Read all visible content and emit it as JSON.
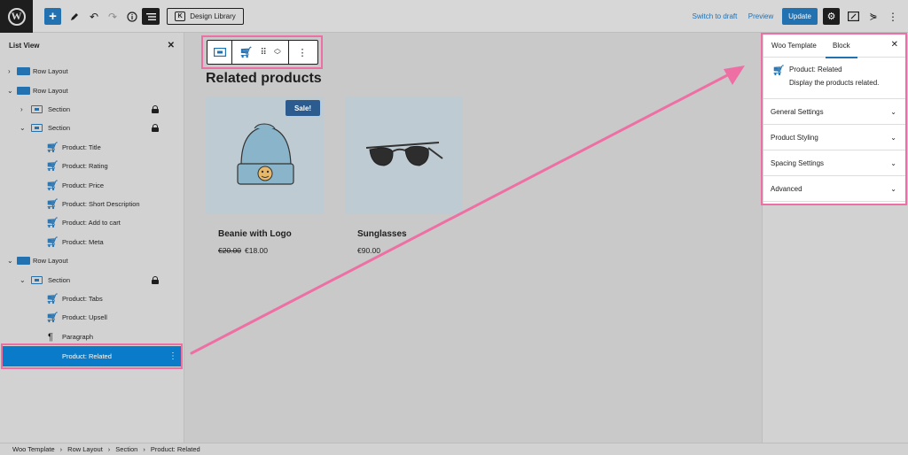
{
  "topbar": {
    "design_library_label": "Design Library",
    "design_library_icon_letter": "K",
    "switch_to_draft": "Switch to draft",
    "preview": "Preview",
    "update": "Update"
  },
  "listview": {
    "title": "List View",
    "items": [
      {
        "label": "Row Layout"
      },
      {
        "label": "Row Layout"
      },
      {
        "label": "Section"
      },
      {
        "label": "Section"
      },
      {
        "label": "Product: Title"
      },
      {
        "label": "Product: Rating"
      },
      {
        "label": "Product: Price"
      },
      {
        "label": "Product: Short Description"
      },
      {
        "label": "Product: Add to cart"
      },
      {
        "label": "Product: Meta"
      },
      {
        "label": "Row Layout"
      },
      {
        "label": "Section"
      },
      {
        "label": "Product: Tabs"
      },
      {
        "label": "Product: Upsell"
      },
      {
        "label": "Paragraph"
      },
      {
        "label": "Product: Related"
      }
    ]
  },
  "canvas": {
    "heading": "Related products",
    "products": [
      {
        "name": "Beanie with Logo",
        "old_price": "€20.00",
        "price": "€18.00",
        "badge": "Sale!"
      },
      {
        "name": "Sunglasses",
        "price": "€90.00"
      }
    ]
  },
  "settings": {
    "tabs": [
      "Woo Template",
      "Block"
    ],
    "active_tab": "Block",
    "block_title": "Product: Related",
    "block_description": "Display the products related.",
    "panels": [
      "General Settings",
      "Product Styling",
      "Spacing Settings",
      "Advanced"
    ]
  },
  "footer": {
    "breadcrumbs": [
      "Woo Template",
      "Row Layout",
      "Section",
      "Product: Related"
    ]
  },
  "colors": {
    "accent": "#2271b1",
    "highlight": "#ee6fa4",
    "selected_row": "#0a7bc8"
  }
}
